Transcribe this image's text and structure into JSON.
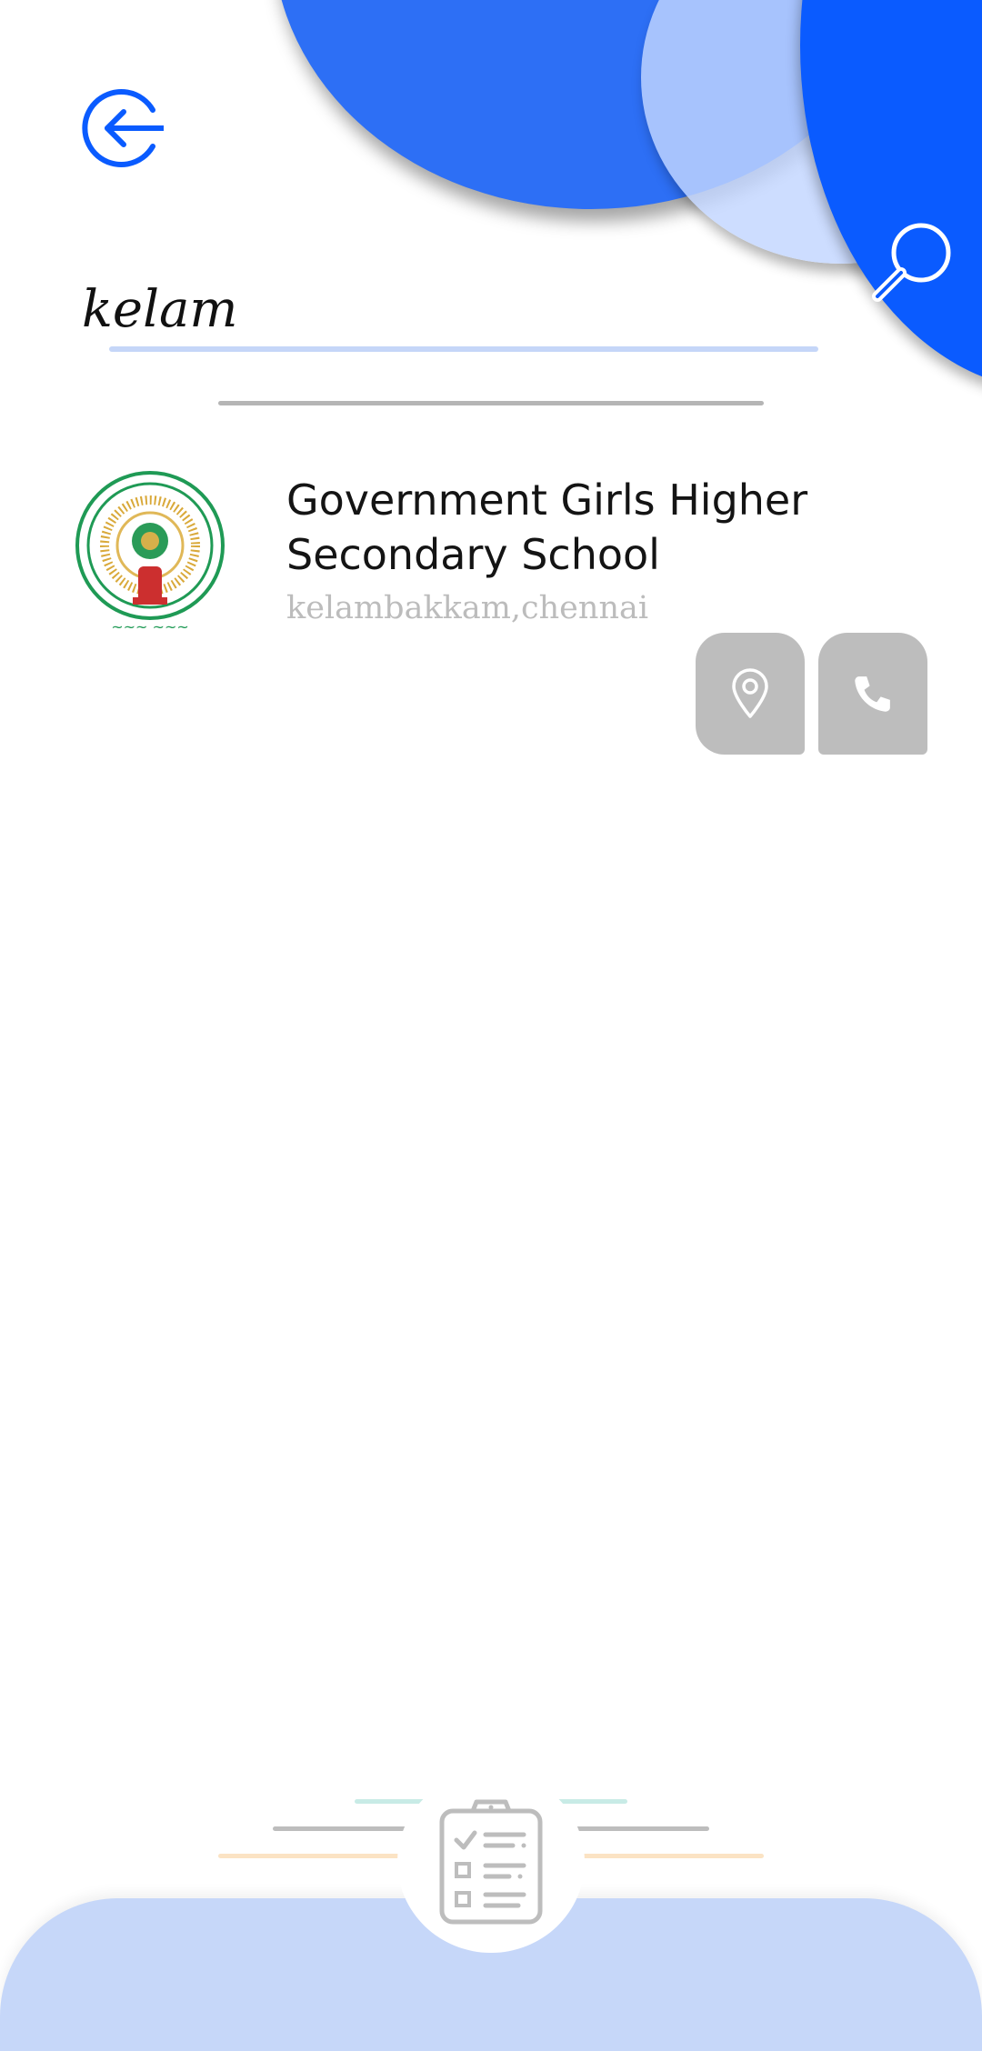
{
  "search": {
    "query": "kelam",
    "placeholder": ""
  },
  "results": [
    {
      "name": "Government Girls Higher Secondary School",
      "address": "kelambakkam,chennai",
      "emblem_icon": "andhra-pradesh-state-emblem",
      "actions": [
        {
          "name": "location",
          "icon": "map-pin-icon"
        },
        {
          "name": "call",
          "icon": "phone-icon"
        }
      ]
    }
  ],
  "colors": {
    "primary_blue": "#0a5bff",
    "light_blue": "#c6d7f9",
    "action_gray": "#bdbdbd",
    "address_gray": "#bcbcbc"
  },
  "icons": {
    "back": "back-arrow-circle-icon",
    "search": "search-icon",
    "bottom_tab": "clipboard-checklist-icon"
  }
}
